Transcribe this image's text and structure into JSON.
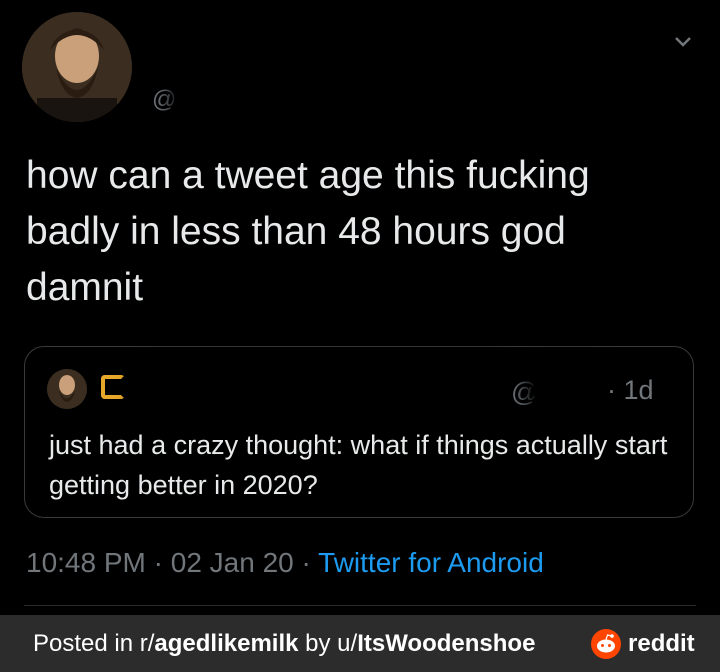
{
  "tweet": {
    "handle_prefix": "@",
    "text": "how can a tweet age this fucking badly in less than 48 hours god damnit",
    "timestamp": "10:48 PM",
    "date": "02 Jan 20",
    "separator": "·",
    "source": "Twitter for Android"
  },
  "quoted_tweet": {
    "handle_prefix": "@",
    "age": "· 1d",
    "text": "just had a crazy thought: what if things actually start getting better in 2020?"
  },
  "footer": {
    "prefix": "Posted in r/",
    "subreddit": "agedlikemilk",
    "by": " by u/",
    "user": "ItsWoodenshoe",
    "brand": "reddit"
  },
  "colors": {
    "background": "#000000",
    "text": "#e7e9ea",
    "muted": "#71767b",
    "link": "#1d9bf0",
    "reddit_orange": "#ff4500",
    "badge": "#e7a72a"
  }
}
